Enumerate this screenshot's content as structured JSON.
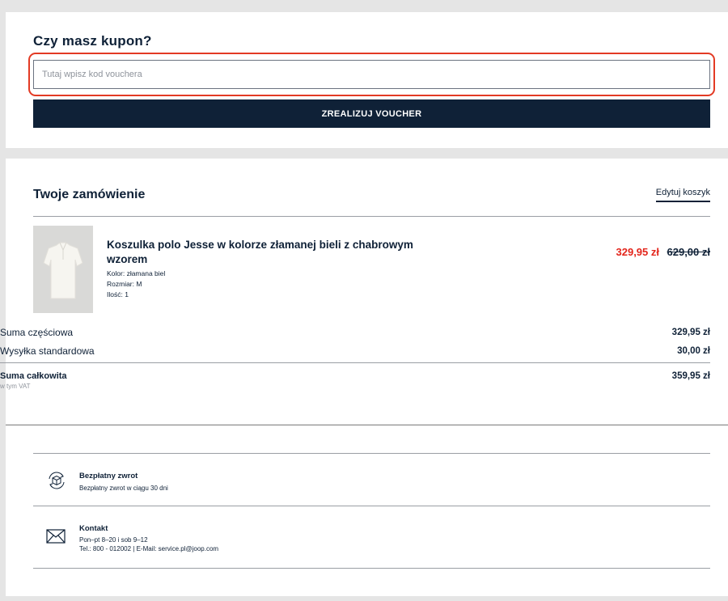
{
  "voucher": {
    "title": "Czy masz kupon?",
    "placeholder": "Tutaj wpisz kod vouchera",
    "value": "",
    "button_label": "ZREALIZUJ VOUCHER",
    "highlight_color": "#e33a24"
  },
  "order": {
    "title": "Twoje zamówienie",
    "edit_label": "Edytuj koszyk",
    "product": {
      "name": "Koszulka polo Jesse w kolorze złamanej bieli z chabrowym wzorem",
      "color": "Kolor: złamana biel",
      "size": "Rozmiar:  M",
      "quantity": "Ilość: 1",
      "price_sale": "329,95 zł",
      "price_old": "629,00 zł",
      "image_icon": "polo-shirt-image"
    },
    "subtotal_label": "Suma częściowa",
    "subtotal_value": "329,95 zł",
    "shipping_label": "Wysyłka standardowa",
    "shipping_value": "30,00 zł",
    "total_label": "Suma całkowita",
    "vat_label": "w tym VAT",
    "total_value": "359,95 zł"
  },
  "info": {
    "returns": {
      "icon": "return-box-icon",
      "title": "Bezpłatny zwrot",
      "text": "Bezpłatny zwrot w ciągu 30 dni"
    },
    "contact": {
      "icon": "envelope-icon",
      "title": "Kontakt",
      "hours": "Pon–pt 8–20 i sob 9–12",
      "details": "Tel.: 800 - 012002 | E-Mail: service.pl@joop.com"
    }
  },
  "colors": {
    "brand_navy": "#0f2137",
    "sale_red": "#e3251b",
    "background": "#e5e5e5"
  }
}
